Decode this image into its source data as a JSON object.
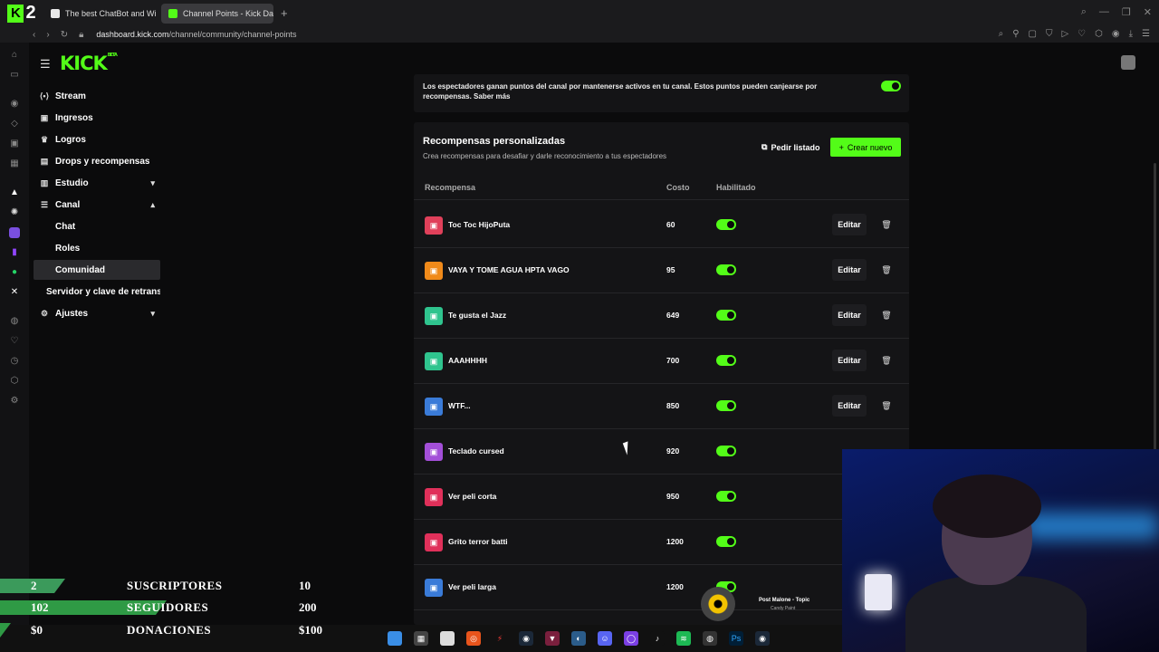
{
  "browser": {
    "tabs": [
      {
        "title": "The best ChatBot and Wi",
        "active": false,
        "icon_color": "#e8e8e8"
      },
      {
        "title": "Channel Points - Kick Das",
        "active": true,
        "icon_color": "#53fc18"
      }
    ],
    "new_tab": "+",
    "url_host": "dashboard.kick.com",
    "url_path": "/channel/community/channel-points"
  },
  "brand": {
    "logo": "KICK",
    "beta": "BETA",
    "accent": "#53fc18"
  },
  "nav": {
    "stream": "Stream",
    "ingresos": "Ingresos",
    "logros": "Logros",
    "drops": "Drops y recompensas",
    "estudio": "Estudio",
    "canal": "Canal",
    "chat": "Chat",
    "roles": "Roles",
    "comunidad": "Comunidad",
    "servidor": "Servidor y clave de retransmisión",
    "ajustes": "Ajustes"
  },
  "points": {
    "description": "Los espectadores ganan puntos del canal por mantenerse activos en tu canal. Estos puntos pueden canjearse por recompensas. Saber más"
  },
  "rewards": {
    "title": "Recompensas personalizadas",
    "subtitle": "Crea recompensas para desafiar y darle reconocimiento a tus espectadores",
    "list_button": "Pedir listado",
    "create_button": "Crear nuevo",
    "columns": {
      "reward": "Recompensa",
      "cost": "Costo",
      "enabled": "Habilitado"
    },
    "edit_label": "Editar",
    "rows": [
      {
        "name": "Toc Toc HijoPuta",
        "cost": "60",
        "color": "#e0405a"
      },
      {
        "name": "VAYA Y TOME AGUA HPTA VAGO",
        "cost": "95",
        "color": "#f08a1a"
      },
      {
        "name": "Te gusta el Jazz",
        "cost": "649",
        "color": "#2fc48e"
      },
      {
        "name": "AAAHHHH",
        "cost": "700",
        "color": "#2fc48e"
      },
      {
        "name": "WTF...",
        "cost": "850",
        "color": "#3a7bd8"
      },
      {
        "name": "Teclado cursed",
        "cost": "920",
        "color": "#a34fd8"
      },
      {
        "name": "Ver peli corta",
        "cost": "950",
        "color": "#e0305a"
      },
      {
        "name": "Grito terror batti",
        "cost": "1200",
        "color": "#e0305a"
      },
      {
        "name": "Ver peli larga",
        "cost": "1200",
        "color": "#3a7bd8"
      }
    ]
  },
  "overlay": {
    "stats": [
      {
        "current": "2",
        "label": "SUSCRIPTORES",
        "goal": "10",
        "fill": 0.2,
        "color": "#3b9a5b"
      },
      {
        "current": "102",
        "label": "SEGUIDORES",
        "goal": "200",
        "fill": 0.51,
        "color": "#2f9a45"
      },
      {
        "current": "$0",
        "label": "DONACIONES",
        "goal": "$100",
        "fill": 0.02,
        "color": "#2f9a45"
      }
    ],
    "music_title": "Post Malone - Topic",
    "music_sub": "Candy Paint"
  }
}
